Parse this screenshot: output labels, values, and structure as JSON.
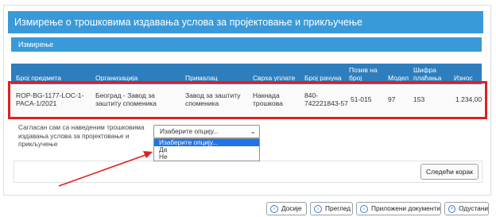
{
  "header": {
    "title": "Измирење о трошковима издавања услова за пројектовање и прикључење",
    "subtitle": "Измирење"
  },
  "table": {
    "columns": [
      "Број предмета",
      "Организација",
      "Прималац",
      "Сврха уплате",
      "Број рачуна",
      "Позив на број",
      "Модел",
      "Шифра плаћања",
      "Износ"
    ],
    "rows": [
      {
        "case_no": "ROP-BG-1177-LOC-1-PACA-1/2021",
        "organization": "Београд - Завод за заштиту споменика",
        "recipient": "Завод за заштиту споменика",
        "purpose": "Накнада трошкова",
        "account": "840-742221843-57",
        "reference": "51-015",
        "model": "97",
        "payment_code": "153",
        "amount": "1.234,00"
      }
    ]
  },
  "agreement": {
    "label": "Сагласан сам са наведеним трошковима издавања услова за пројектовање и прикључење",
    "select_value": "Изаберите опцију...",
    "options": [
      "Изаберите опцију...",
      "Да",
      "Не"
    ]
  },
  "buttons": {
    "next": "Следећи корак",
    "dossier": "Досије",
    "preview": "Преглед",
    "attachments": "Приложени документи",
    "cancel": "Одустани"
  },
  "colors": {
    "header_blue": "#3a9ad9",
    "table_header_blue": "#2e7ebd",
    "highlight_red": "#e02020",
    "dropdown_selected": "#1e73e8"
  }
}
